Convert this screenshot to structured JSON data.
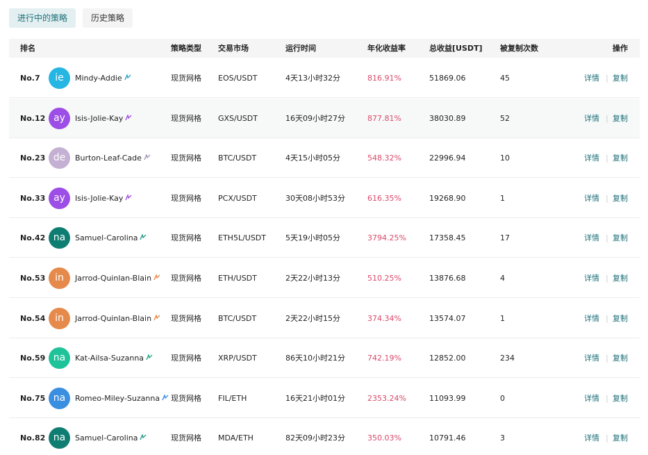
{
  "tabs": [
    {
      "label": "进行中的策略",
      "active": true
    },
    {
      "label": "历史策略",
      "active": false
    }
  ],
  "columns": {
    "rank": "排名",
    "type": "策略类型",
    "market": "交易市场",
    "runtime": "运行时间",
    "apr": "年化收益率",
    "total": "总收益[USDT]",
    "copies": "被复制次数",
    "actions": "操作"
  },
  "actions": {
    "detail": "详情",
    "copy": "复制",
    "separator": "|"
  },
  "colors": {
    "accent": "#1b6f78",
    "positive_rate": "#d94a6a"
  },
  "rows": [
    {
      "rank": "No.7",
      "initials": "ie",
      "avatar_color": "#26b6e3",
      "name": "Mindy-Addie",
      "badge_color": "#2aa3c9",
      "type": "现货网格",
      "market": "EOS/USDT",
      "runtime": "4天13小时32分",
      "apr": "816.91%",
      "total": "51869.06",
      "copies": "45"
    },
    {
      "rank": "No.12",
      "initials": "ay",
      "avatar_color": "#9d4ee6",
      "name": "Isis-Jolie-Kay",
      "badge_color": "#9d4ee6",
      "type": "现货网格",
      "market": "GXS/USDT",
      "runtime": "16天09小时27分",
      "apr": "877.81%",
      "total": "38030.89",
      "copies": "52"
    },
    {
      "rank": "No.23",
      "initials": "de",
      "avatar_color": "#c4b0d3",
      "name": "Burton-Leaf-Cade",
      "badge_color": "#a897b4",
      "type": "现货网格",
      "market": "BTC/USDT",
      "runtime": "4天15小时05分",
      "apr": "548.32%",
      "total": "22996.94",
      "copies": "10"
    },
    {
      "rank": "No.33",
      "initials": "ay",
      "avatar_color": "#9d4ee6",
      "name": "Isis-Jolie-Kay",
      "badge_color": "#9d4ee6",
      "type": "现货网格",
      "market": "PCX/USDT",
      "runtime": "30天08小时53分",
      "apr": "616.35%",
      "total": "19268.90",
      "copies": "1"
    },
    {
      "rank": "No.42",
      "initials": "na",
      "avatar_color": "#0f7e72",
      "name": "Samuel-Carolina",
      "badge_color": "#2a9a8d",
      "type": "现货网格",
      "market": "ETH5L/USDT",
      "runtime": "5天19小时05分",
      "apr": "3794.25%",
      "total": "17358.45",
      "copies": "17"
    },
    {
      "rank": "No.53",
      "initials": "in",
      "avatar_color": "#e68a4c",
      "name": "Jarrod-Quinlan-Blain",
      "badge_color": "#e68a4c",
      "type": "现货网格",
      "market": "ETH/USDT",
      "runtime": "2天22小时13分",
      "apr": "510.25%",
      "total": "13876.68",
      "copies": "4"
    },
    {
      "rank": "No.54",
      "initials": "in",
      "avatar_color": "#e68a4c",
      "name": "Jarrod-Quinlan-Blain",
      "badge_color": "#e68a4c",
      "type": "现货网格",
      "market": "BTC/USDT",
      "runtime": "2天22小时15分",
      "apr": "374.34%",
      "total": "13574.07",
      "copies": "1"
    },
    {
      "rank": "No.59",
      "initials": "na",
      "avatar_color": "#1ec39a",
      "name": "Kat-Ailsa-Suzanna",
      "badge_color": "#1ea985",
      "type": "现货网格",
      "market": "XRP/USDT",
      "runtime": "86天10小时21分",
      "apr": "742.19%",
      "total": "12852.00",
      "copies": "234"
    },
    {
      "rank": "No.75",
      "initials": "na",
      "avatar_color": "#3b8fe0",
      "name": "Romeo-Miley-Suzanna",
      "badge_color": "#3b8fe0",
      "type": "现货网格",
      "market": "FIL/ETH",
      "runtime": "16天21小时01分",
      "apr": "2353.24%",
      "total": "11093.99",
      "copies": "0"
    },
    {
      "rank": "No.82",
      "initials": "na",
      "avatar_color": "#0f7e72",
      "name": "Samuel-Carolina",
      "badge_color": "#2a9a8d",
      "type": "现货网格",
      "market": "MDA/ETH",
      "runtime": "82天09小时23分",
      "apr": "350.03%",
      "total": "10791.46",
      "copies": "3"
    }
  ]
}
